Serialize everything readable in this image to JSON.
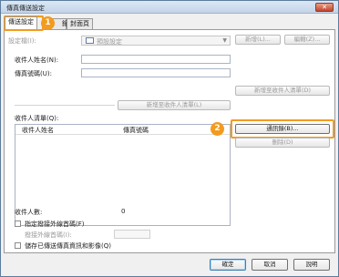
{
  "window": {
    "title": "傳真傳送設定",
    "close_label": "✕"
  },
  "tabs": [
    {
      "label": "傳送設定",
      "active": true
    },
    {
      "label": "詳細設定",
      "active": false
    },
    {
      "label": "封面頁",
      "active": false
    }
  ],
  "tab_partial": "錄",
  "callouts": {
    "one": "1",
    "two": "2"
  },
  "sender": {
    "label": "設定檔(I):",
    "value": "預設設定",
    "new_button": "新增(L)...",
    "edit_button": "編輯(Z)..."
  },
  "recipient": {
    "name_label": "收件人姓名(N):",
    "fax_label": "傳真號碼(U):",
    "name_value": "",
    "fax_value": "",
    "add_detail_button": "新增至收件人清單(D)",
    "add_to_list_button": "新增至收件人清單(L)"
  },
  "recipient_list": {
    "label": "收件人清單(Q):",
    "columns": [
      "收件人姓名",
      "傳真號碼"
    ],
    "rows": [],
    "count_label": "收件人數:",
    "count_value": "0"
  },
  "actions": {
    "address_book_button": "通訊錄(B)...",
    "delete_button": "刪除(D)"
  },
  "options": {
    "outside_line_label": "指定撥接外線首碼(F)",
    "outside_prefix_label": "撥接外線首碼(I):",
    "outside_prefix_value": "",
    "save_info_label": "儲存已傳送傳真資訊和影像(Q)"
  },
  "footer": {
    "ok": "確定",
    "cancel": "取消",
    "help": "說明"
  }
}
